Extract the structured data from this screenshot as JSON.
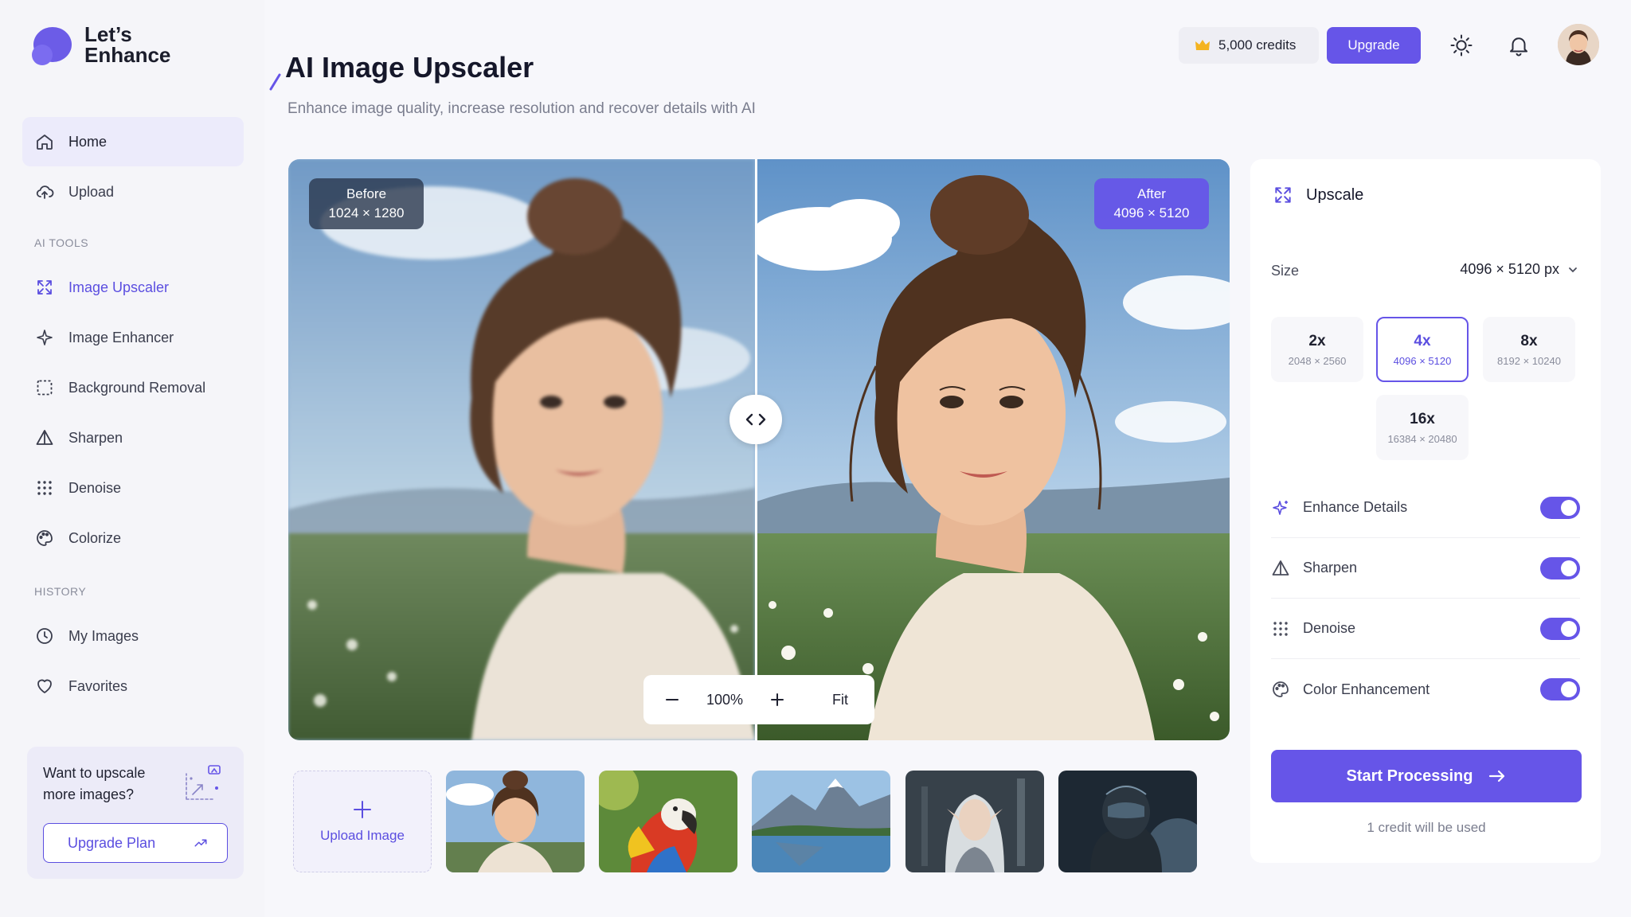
{
  "brand": {
    "name_line1": "Let’s",
    "name_line2": "Enhance"
  },
  "colors": {
    "accent": "#6655e8",
    "accent_text": "#5b4ee0",
    "sidebar_bg": "#f5f5f9",
    "page_bg": "#f7f7fb"
  },
  "sidebar": {
    "nav": [
      {
        "label": "Home",
        "icon": "home-icon"
      },
      {
        "label": "Upload",
        "icon": "cloud-upload-icon"
      }
    ],
    "ai_tools_label": "AI TOOLS",
    "ai_tools": [
      {
        "label": "Image Upscaler",
        "icon": "expand-icon"
      },
      {
        "label": "Image Enhancer",
        "icon": "sparkle-icon"
      },
      {
        "label": "Background Removal",
        "icon": "dashed-square-icon"
      },
      {
        "label": "Sharpen",
        "icon": "triangle-icon"
      },
      {
        "label": "Denoise",
        "icon": "dots-grid-icon"
      },
      {
        "label": "Colorize",
        "icon": "palette-icon"
      }
    ],
    "history_label": "HISTORY",
    "history": [
      {
        "label": "My Images",
        "icon": "clock-icon"
      },
      {
        "label": "Favorites",
        "icon": "heart-icon"
      }
    ],
    "promo": {
      "text": "Want to upscale more images?",
      "button": "Upgrade Plan"
    }
  },
  "header": {
    "title": "AI Image Upscaler",
    "subtitle": "Enhance image quality, increase resolution and recover details with AI",
    "credits": "5,000 credits",
    "upgrade": "Upgrade",
    "icons": [
      "sun-icon",
      "bell-icon",
      "avatar"
    ]
  },
  "viewer": {
    "before_label": "Before",
    "before_size": "1024 × 1280",
    "after_label": "After",
    "after_size": "4096 × 5120",
    "zoom": "100%",
    "fit": "Fit"
  },
  "thumbnails": {
    "upload_label": "Upload Image",
    "items": [
      "portrait",
      "parrot",
      "mountain-lake",
      "elf",
      "robot"
    ]
  },
  "panel": {
    "title": "Upscale",
    "size_label": "Size",
    "size_value": "4096 × 5120 px",
    "options": [
      {
        "mult": "2x",
        "dims": "2048 × 2560",
        "selected": false
      },
      {
        "mult": "4x",
        "dims": "4096 × 5120",
        "selected": true
      },
      {
        "mult": "8x",
        "dims": "8192 × 10240",
        "selected": false
      },
      {
        "mult": "16x",
        "dims": "16384 × 20480",
        "selected": false
      }
    ],
    "toggles": [
      {
        "label": "Enhance Details",
        "on": true
      },
      {
        "label": "Sharpen",
        "on": true
      },
      {
        "label": "Denoise",
        "on": true
      },
      {
        "label": "Color Enhancement",
        "on": true
      }
    ],
    "start": "Start Processing",
    "credit_note": "1 credit will be used"
  }
}
